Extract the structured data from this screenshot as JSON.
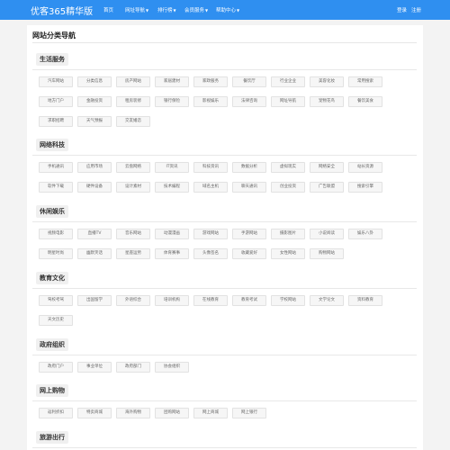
{
  "header": {
    "logo": "优客365精华版",
    "nav": [
      {
        "label": "首页",
        "has_caret": false
      },
      {
        "label": "网址导航",
        "has_caret": true
      },
      {
        "label": "排行榜",
        "has_caret": true
      },
      {
        "label": "会员服务",
        "has_caret": true
      },
      {
        "label": "帮助中心",
        "has_caret": true
      }
    ],
    "login": "登录",
    "register": "注册"
  },
  "page_title": "网站分类导航",
  "categories": [
    {
      "name": "生活服务",
      "items": [
        "汽车网站",
        "分类信息",
        "房产网站",
        "家居建材",
        "家政服务",
        "餐饮厅",
        "行业企业",
        "美容化妆",
        "常用搜索",
        "地方门户",
        "金融投资",
        "租房装修",
        "银行保险",
        "影视娱乐",
        "法律咨询",
        "网址导航",
        "宠物花鸟",
        "餐饮美食",
        "求职招聘",
        "天气预报",
        "交友婚恋"
      ]
    },
    {
      "name": "网络科技",
      "items": [
        "手机通讯",
        "应用市场",
        "云盘网络",
        "IT资讯",
        "科技资讯",
        "数据分析",
        "虚拟现实",
        "网络安全",
        "站长资源",
        "软件下载",
        "硬件设备",
        "设计素材",
        "技术编程",
        "域名主机",
        "聊天通讯",
        "创业投资",
        "广告联盟",
        "搜索引擎"
      ]
    },
    {
      "name": "休闲娱乐",
      "items": [
        "视频电影",
        "直播TV",
        "音乐网站",
        "动漫漫画",
        "游戏网站",
        "手游网站",
        "摄影图片",
        "小说阅读",
        "娱乐八卦",
        "明星时尚",
        "幽默笑话",
        "星座运势",
        "体育赛事",
        "头像签名",
        "收藏爱好",
        "女性网站",
        "购物网站"
      ]
    },
    {
      "name": "教育文化",
      "items": [
        "驾校考驾",
        "出国留学",
        "外语综合",
        "培训机构",
        "在线教育",
        "教育考试",
        "学校网站",
        "文学论文",
        "资料教育",
        "天文历史"
      ]
    },
    {
      "name": "政府组织",
      "items": [
        "政府门户",
        "事业单位",
        "政府部门",
        "协会组织"
      ]
    },
    {
      "name": "网上购物",
      "items": [
        "返利折扣",
        "特卖商城",
        "海外购物",
        "团购网站",
        "网上商城",
        "网上银行"
      ]
    },
    {
      "name": "旅游出行",
      "items": []
    }
  ]
}
